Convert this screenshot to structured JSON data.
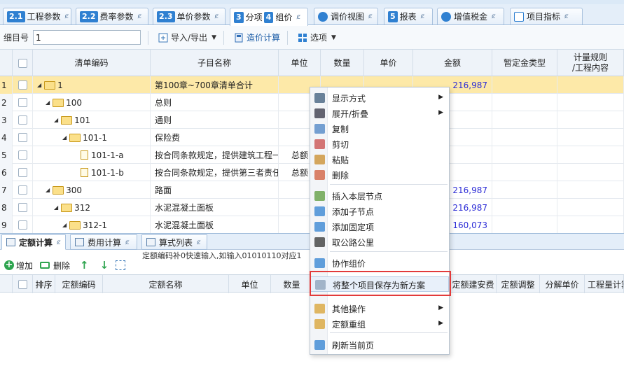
{
  "top_tabs": [
    {
      "num": "2.1",
      "label": "工程参数"
    },
    {
      "num": "2.2",
      "label": "费率参数"
    },
    {
      "num": "2.3",
      "label": "单价参数"
    },
    {
      "num": "3",
      "label": "分项",
      "num2": "4",
      "label2": "组价"
    },
    {
      "label": "调价视图"
    },
    {
      "num": "5",
      "label": "报表"
    },
    {
      "label": "增值税金"
    },
    {
      "label": "项目指标"
    }
  ],
  "pin_glyph": "ȼ",
  "toolbar": {
    "item_label": "细目号",
    "item_value": "1",
    "import_export": "导入/导出",
    "pricing_calc": "造价计算",
    "options": "选项"
  },
  "grid": {
    "headers": [
      "清单编码",
      "子目名称",
      "单位",
      "数量",
      "单价",
      "金额",
      "暂定金类型",
      "计量规则\n/工程内容"
    ],
    "rows": [
      {
        "n": "1",
        "code": "1",
        "name": "第100章~700章清单合计",
        "unit": "",
        "amount": "216,987",
        "icon": "folder",
        "indent": 0,
        "sel": true
      },
      {
        "n": "2",
        "code": "100",
        "name": "总则",
        "unit": "",
        "amount": "",
        "icon": "folder",
        "indent": 1
      },
      {
        "n": "3",
        "code": "101",
        "name": "通则",
        "unit": "",
        "amount": "",
        "icon": "folder",
        "indent": 2
      },
      {
        "n": "4",
        "code": "101-1",
        "name": "保险费",
        "unit": "",
        "amount": "",
        "icon": "folder",
        "indent": 3
      },
      {
        "n": "5",
        "code": "101-1-a",
        "name": "按合同条款规定，提供建筑工程一",
        "unit": "总额",
        "amount": "",
        "icon": "doc",
        "indent": 4
      },
      {
        "n": "6",
        "code": "101-1-b",
        "name": "按合同条款规定，提供第三者责任",
        "unit": "总额",
        "amount": "",
        "icon": "doc",
        "indent": 4
      },
      {
        "n": "7",
        "code": "300",
        "name": "路面",
        "unit": "",
        "amount": "216,987",
        "icon": "folder",
        "indent": 1
      },
      {
        "n": "8",
        "code": "312",
        "name": "水泥混凝土面板",
        "unit": "",
        "amount": "216,987",
        "icon": "folder",
        "indent": 2
      },
      {
        "n": "9",
        "code": "312-1",
        "name": "水泥混凝土面板",
        "unit": "",
        "amount": "160,073",
        "icon": "folder",
        "indent": 3
      }
    ]
  },
  "bottom_tabs": [
    "定额计算",
    "费用计算",
    "算式列表"
  ],
  "hint": "定额编码补0快速输入,如输入01010110对应1",
  "bottom_toolbar": {
    "add": "增加",
    "delete": "删除"
  },
  "bottom_headers": [
    "排序",
    "定额编码",
    "定额名称",
    "单位",
    "数量",
    "定额建安费",
    "定额调整",
    "分解单价",
    "工程量计算"
  ],
  "context_menu": [
    {
      "label": "显示方式",
      "sub": true
    },
    {
      "label": "展开/折叠",
      "sub": true
    },
    {
      "label": "复制"
    },
    {
      "label": "剪切"
    },
    {
      "label": "粘贴"
    },
    {
      "label": "删除"
    },
    {
      "label": "插入本层节点"
    },
    {
      "label": "添加子节点"
    },
    {
      "label": "添加固定项"
    },
    {
      "label": "取公路公里"
    },
    {
      "label": "协作组价"
    },
    {
      "label": "将整个项目保存为新方案"
    },
    {
      "label": "其他操作",
      "sub": true
    },
    {
      "label": "定额重组",
      "sub": true
    },
    {
      "label": "刷新当前页"
    }
  ]
}
